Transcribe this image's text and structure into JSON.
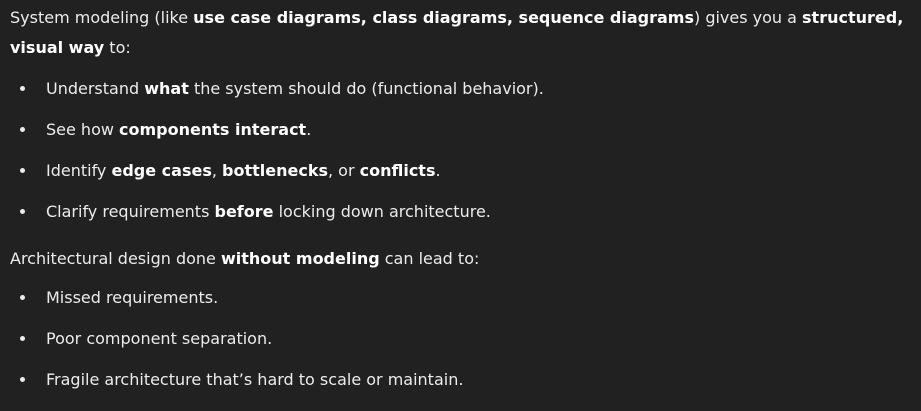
{
  "intro": {
    "line1": [
      {
        "text": "System modeling (like ",
        "bold": false
      },
      {
        "text": "use case diagrams, class diagrams, sequence diagrams",
        "bold": true
      },
      {
        "text": ") gives you a ",
        "bold": false
      },
      {
        "text": "structured,",
        "bold": true
      }
    ],
    "line2": [
      {
        "text": "visual way",
        "bold": true
      },
      {
        "text": " to:",
        "bold": false
      }
    ]
  },
  "benefits": [
    [
      {
        "text": "Understand ",
        "bold": false
      },
      {
        "text": "what",
        "bold": true
      },
      {
        "text": " the system should do (functional behavior).",
        "bold": false
      }
    ],
    [
      {
        "text": "See how ",
        "bold": false
      },
      {
        "text": "components interact",
        "bold": true
      },
      {
        "text": ".",
        "bold": false
      }
    ],
    [
      {
        "text": "Identify ",
        "bold": false
      },
      {
        "text": "edge cases",
        "bold": true
      },
      {
        "text": ", ",
        "bold": false
      },
      {
        "text": "bottlenecks",
        "bold": true
      },
      {
        "text": ", or ",
        "bold": false
      },
      {
        "text": "conflicts",
        "bold": true
      },
      {
        "text": ".",
        "bold": false
      }
    ],
    [
      {
        "text": "Clarify requirements ",
        "bold": false
      },
      {
        "text": "before",
        "bold": true
      },
      {
        "text": " locking down architecture.",
        "bold": false
      }
    ]
  ],
  "risk_intro": [
    {
      "text": "Architectural design done ",
      "bold": false
    },
    {
      "text": "without modeling",
      "bold": true
    },
    {
      "text": " can lead to:",
      "bold": false
    }
  ],
  "risks": [
    [
      {
        "text": "Missed requirements.",
        "bold": false
      }
    ],
    [
      {
        "text": "Poor component separation.",
        "bold": false
      }
    ],
    [
      {
        "text": "Fragile architecture that’s hard to scale or maintain.",
        "bold": false
      }
    ]
  ]
}
